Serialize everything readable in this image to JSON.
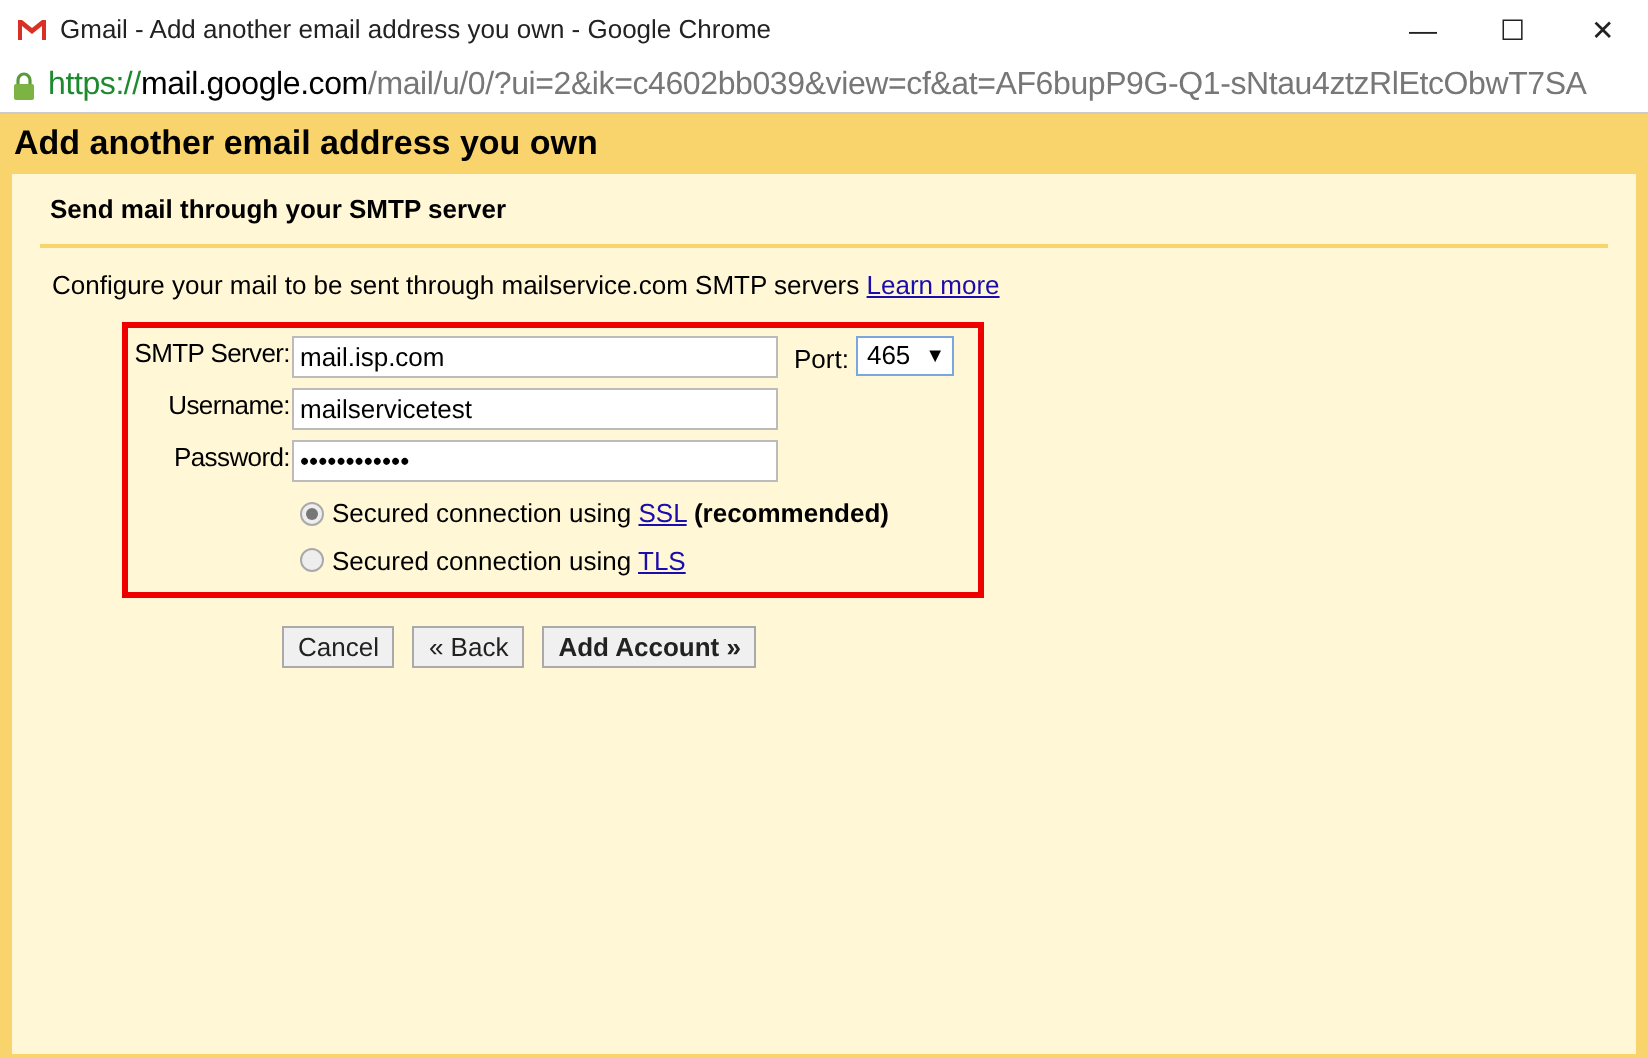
{
  "window": {
    "title": "Gmail - Add another email address you own - Google Chrome",
    "controls": [
      "—",
      "☐",
      "✕"
    ]
  },
  "address_bar": {
    "scheme": "https://",
    "host": "mail.google.com",
    "path": "/mail/u/0/?ui=2&ik=c4602bb039&view=cf&at=AF6bupP9G-Q1-sNtau4ztzRlEtcObwT7SA"
  },
  "header": {
    "title": "Add another email address you own"
  },
  "section": {
    "title": "Send mail through your SMTP server",
    "description": "Configure your mail to be sent through mailservice.com SMTP servers",
    "link": "Learn more"
  },
  "form": {
    "fields": [
      {
        "label": "SMTP Server:",
        "value": "mail.isp.com"
      },
      {
        "label": "Username:",
        "value": "mailservicetest"
      },
      {
        "label": "Password:",
        "value": "••••••••••••"
      }
    ],
    "port": {
      "label": "Port:",
      "value": "465",
      "arrow": "▼"
    },
    "options": [
      {
        "text": "Secured connection using",
        "link": "SSL",
        "note": "**(recommended)**",
        "selected": true
      },
      {
        "text": "Secured connection using",
        "link": "TLS",
        "selected": false
      }
    ]
  },
  "buttons": [
    {
      "label": "Cancel",
      "kind": "normal"
    },
    {
      "label": "« Back",
      "kind": "normal"
    },
    {
      "label": "Add Account »",
      "kind": "primary"
    }
  ]
}
